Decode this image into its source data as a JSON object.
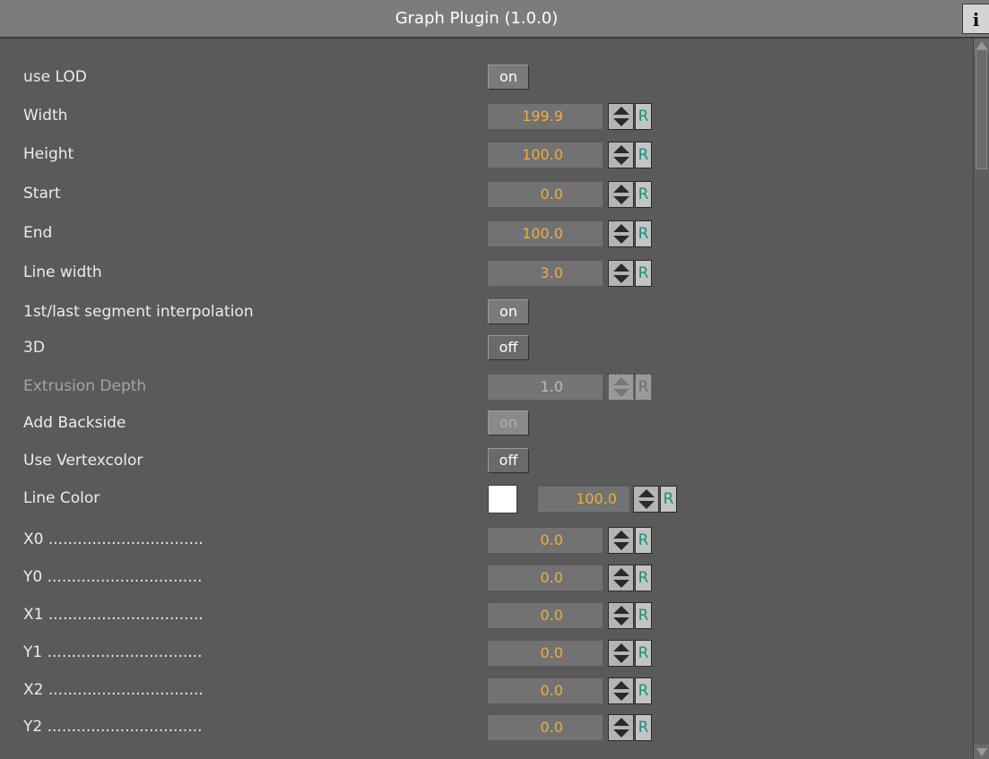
{
  "title": "Graph Plugin (1.0.0)",
  "info_label": "i",
  "reset_label": "R",
  "colors": {
    "value_text": "#f0ad3c",
    "background": "#5a5a5a",
    "line_color": "#ffffff"
  },
  "fields": {
    "use_lod": {
      "label": "use LOD",
      "value": "on"
    },
    "width": {
      "label": "Width",
      "value": "199.9"
    },
    "height": {
      "label": "Height",
      "value": "100.0"
    },
    "start": {
      "label": "Start",
      "value": "0.0"
    },
    "end": {
      "label": "End",
      "value": "100.0"
    },
    "line_width": {
      "label": "Line width",
      "value": "3.0"
    },
    "seg_interp": {
      "label": "1st/last segment interpolation",
      "value": "on"
    },
    "three_d": {
      "label": "3D",
      "value": "off"
    },
    "extrusion_depth": {
      "label": "Extrusion Depth",
      "value": "1.0"
    },
    "add_backside": {
      "label": "Add Backside",
      "value": "on"
    },
    "use_vertexcolor": {
      "label": "Use Vertexcolor",
      "value": "off"
    },
    "line_color": {
      "label": "Line Color",
      "value": "100.0"
    },
    "x0": {
      "label": "X0 ................................",
      "value": "0.0"
    },
    "y0": {
      "label": "Y0 ................................",
      "value": "0.0"
    },
    "x1": {
      "label": "X1 ................................",
      "value": "0.0"
    },
    "y1": {
      "label": "Y1 ................................",
      "value": "0.0"
    },
    "x2": {
      "label": "X2 ................................",
      "value": "0.0"
    },
    "y2": {
      "label": "Y2 ................................",
      "value": "0.0"
    }
  }
}
